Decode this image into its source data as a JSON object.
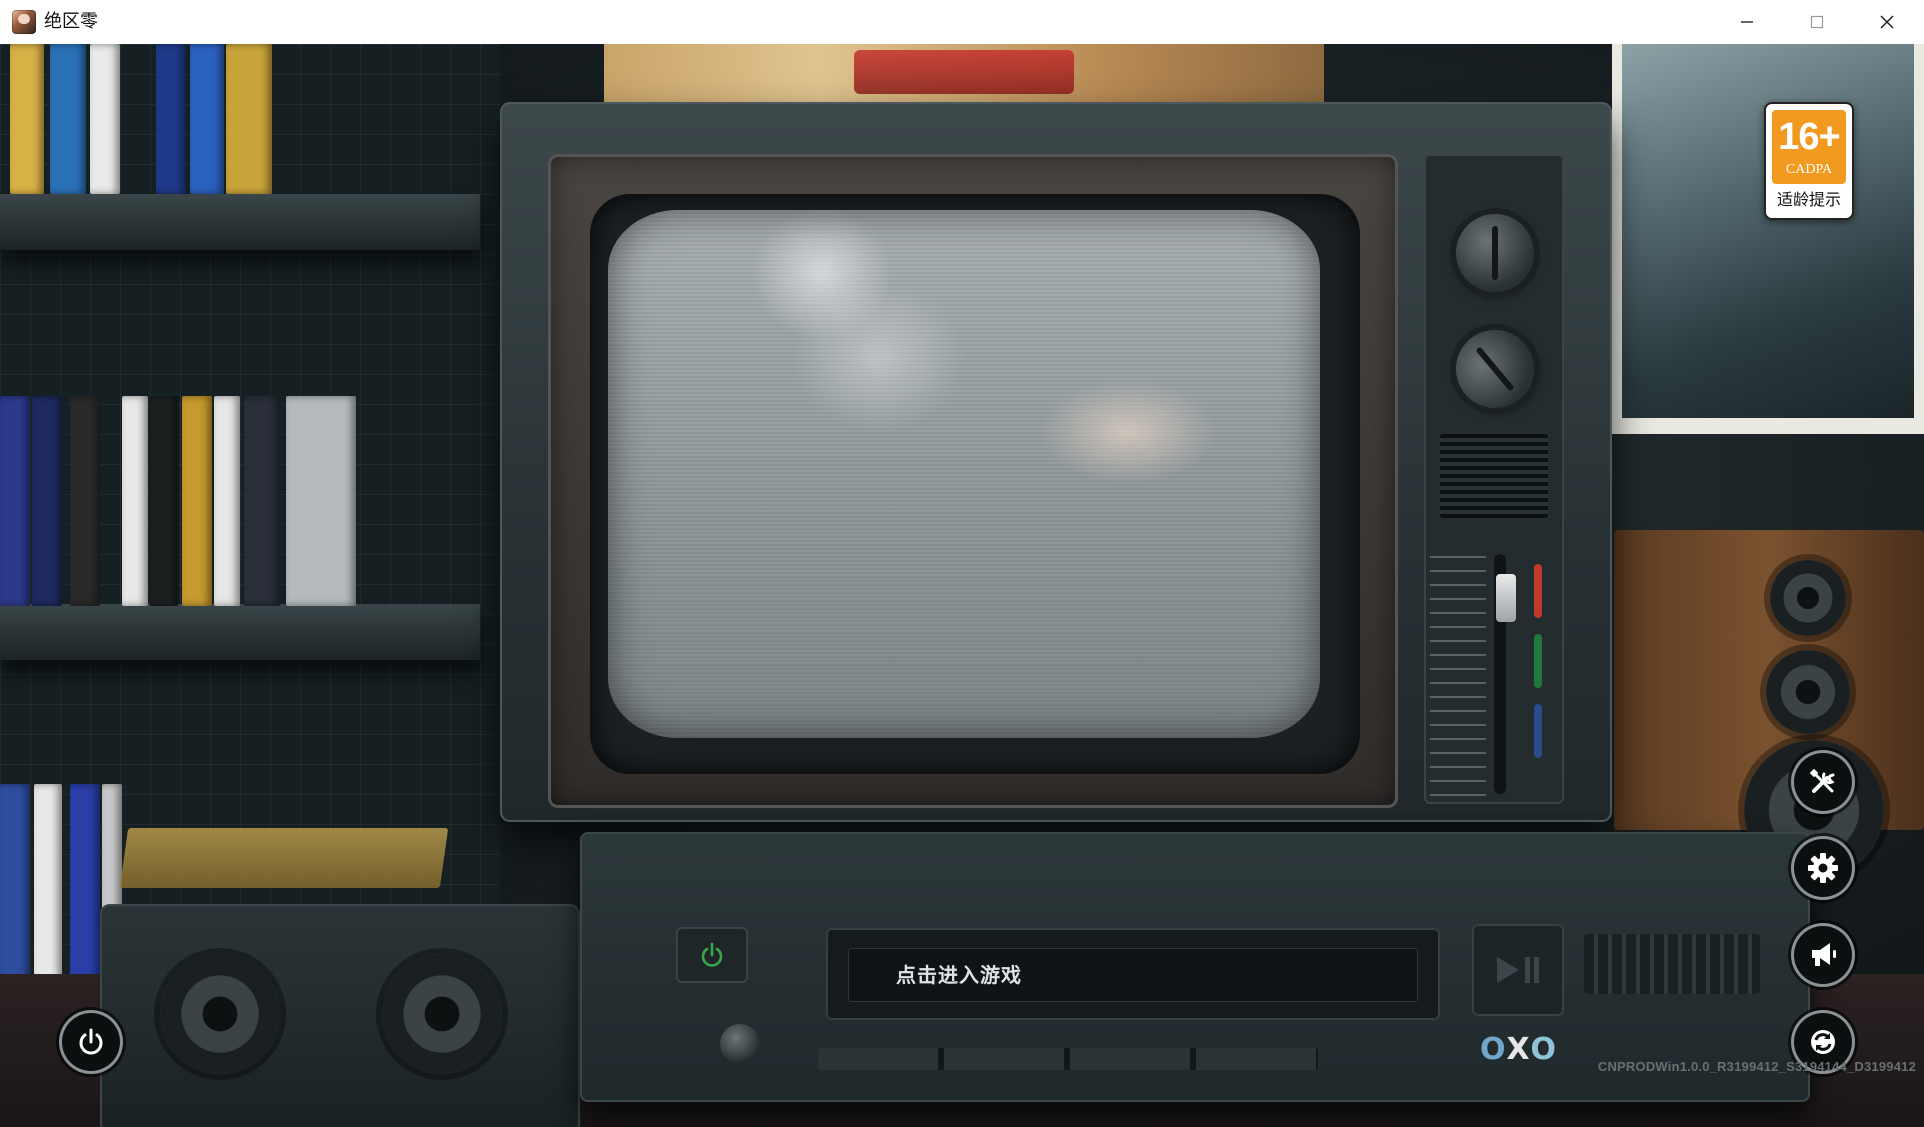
{
  "window": {
    "title": "绝区零",
    "controls": {
      "minimize_icon": "minimize-icon",
      "maximize_icon": "maximize-icon",
      "close_icon": "close-icon"
    }
  },
  "main": {
    "enter_game": "点击进入游戏",
    "version": "CNPRODWin1.0.0_R3199412_S3194144_D3199412",
    "brand_logo": [
      "O",
      "X",
      "O"
    ]
  },
  "rating": {
    "age": "16+",
    "org": "CADPA",
    "note": "适龄提示",
    "color": "#f29a1f"
  },
  "side_buttons": [
    {
      "icon": "tools-icon",
      "name": "tools-button"
    },
    {
      "icon": "gear-icon",
      "name": "settings-button"
    },
    {
      "icon": "megaphone-icon",
      "name": "announcement-button"
    },
    {
      "icon": "refresh-icon",
      "name": "refresh-button"
    }
  ],
  "power_button": {
    "icon": "power-icon"
  },
  "colors": {
    "led_red": "#c0392b",
    "led_green": "#1f7a3b",
    "led_blue": "#2a4b8c"
  }
}
